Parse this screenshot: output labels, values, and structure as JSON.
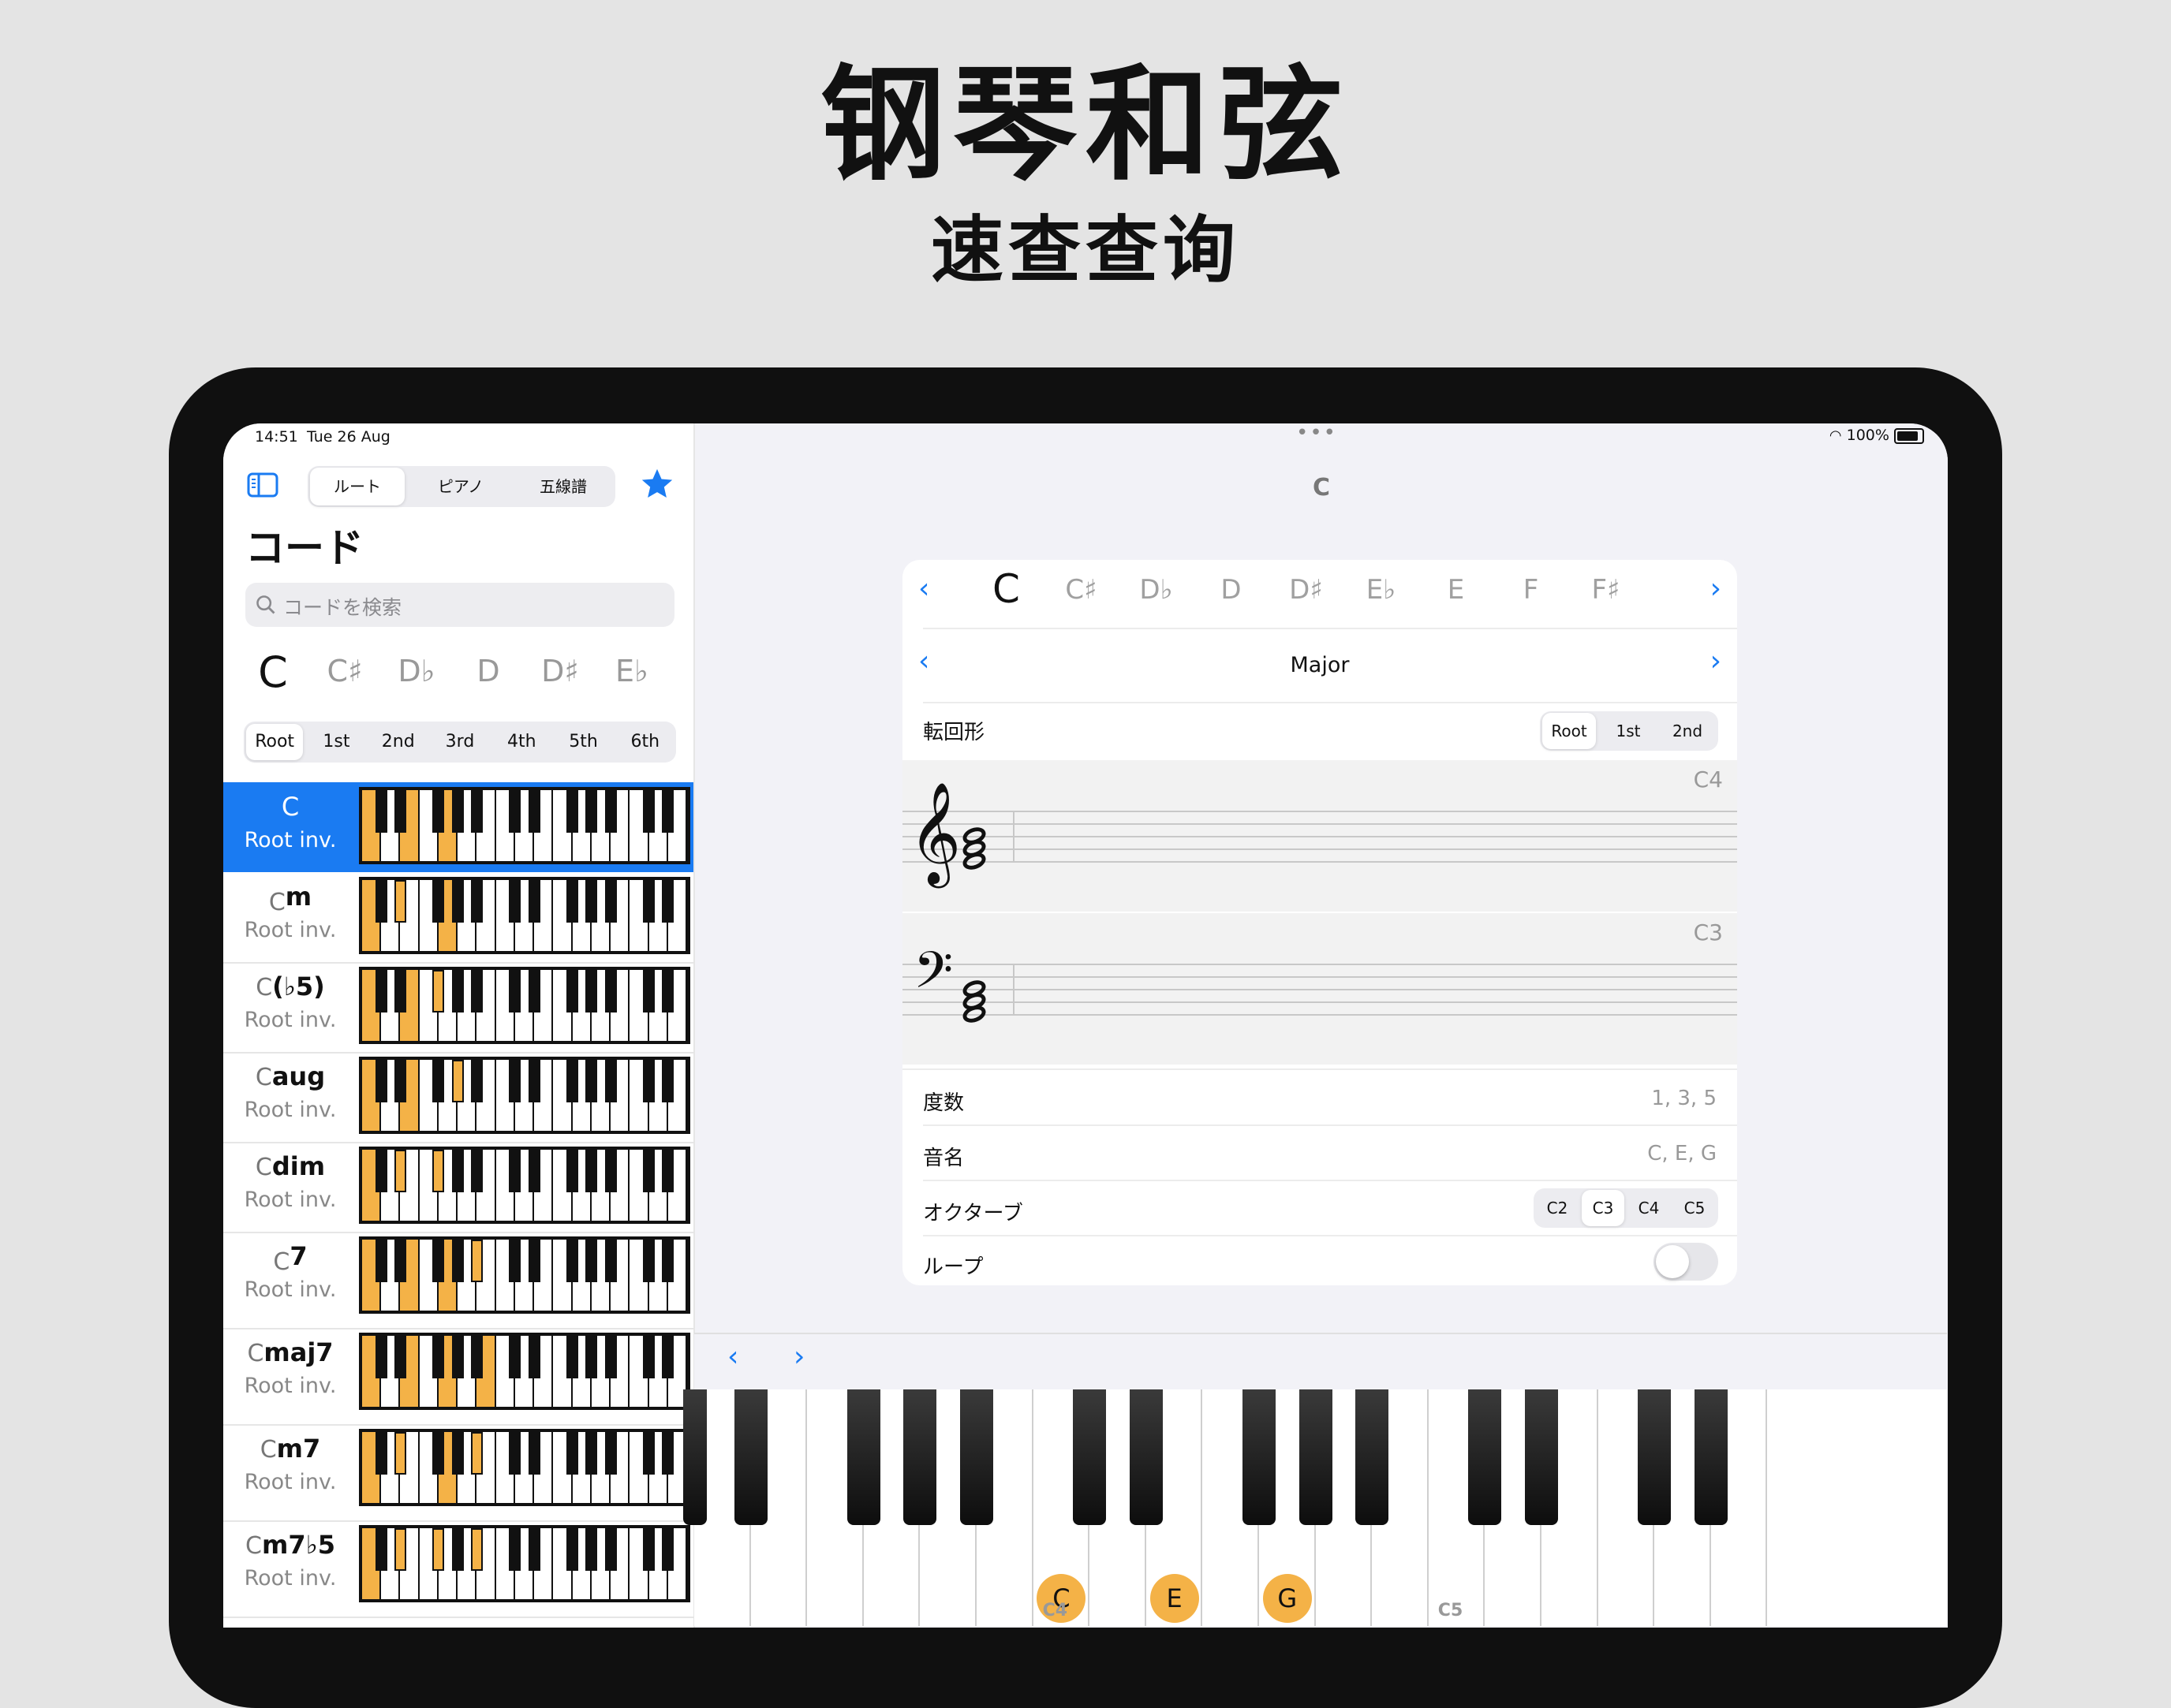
{
  "promo": {
    "title": "钢琴和弦",
    "subtitle": "速查查询"
  },
  "status": {
    "time": "14:51",
    "date": "Tue 26 Aug",
    "battery": "100%"
  },
  "sidebar": {
    "mode_tabs": [
      "ルート",
      "ピアノ",
      "五線譜"
    ],
    "mode_selected": 0,
    "heading": "コード",
    "search_placeholder": "コードを検索",
    "root_notes": [
      "C",
      "C♯",
      "D♭",
      "D",
      "D♯",
      "E♭"
    ],
    "root_selected": 0,
    "inversions": [
      "Root",
      "1st",
      "2nd",
      "3rd",
      "4th",
      "5th",
      "6th"
    ],
    "inversion_selected": 0,
    "chords": [
      {
        "root": "C",
        "quality": "",
        "inv": "Root inv.",
        "notes": [
          0,
          4,
          7
        ],
        "selected": true
      },
      {
        "root": "C",
        "quality": "m",
        "inv": "Root inv.",
        "notes": [
          0,
          3,
          7
        ],
        "selected": false
      },
      {
        "root": "C",
        "quality": "(♭5)",
        "inv": "Root inv.",
        "notes": [
          0,
          4,
          6
        ],
        "selected": false
      },
      {
        "root": "C",
        "quality": "aug",
        "inv": "Root inv.",
        "notes": [
          0,
          4,
          8
        ],
        "selected": false
      },
      {
        "root": "C",
        "quality": "dim",
        "inv": "Root inv.",
        "notes": [
          0,
          3,
          6
        ],
        "selected": false
      },
      {
        "root": "C",
        "quality": "7",
        "inv": "Root inv.",
        "notes": [
          0,
          4,
          7,
          10
        ],
        "selected": false
      },
      {
        "root": "C",
        "quality": "maj7",
        "inv": "Root inv.",
        "notes": [
          0,
          4,
          7,
          11
        ],
        "selected": false
      },
      {
        "root": "C",
        "quality": "m7",
        "inv": "Root inv.",
        "notes": [
          0,
          3,
          7,
          10
        ],
        "selected": false
      },
      {
        "root": "C",
        "quality": "m7♭5",
        "inv": "Root inv.",
        "notes": [
          0,
          3,
          6,
          10
        ],
        "selected": false
      }
    ]
  },
  "detail": {
    "title": "C",
    "note_nav": [
      "C",
      "C♯",
      "D♭",
      "D",
      "D♯",
      "E♭",
      "E",
      "F",
      "F♯"
    ],
    "note_selected": 0,
    "quality": "Major",
    "inversion_label": "転回形",
    "inversion_options": [
      "Root",
      "1st",
      "2nd"
    ],
    "inversion_selected": 0,
    "treble_octave": "C4",
    "bass_octave": "C3",
    "degree_label": "度数",
    "degree_value": "1, 3, 5",
    "notename_label": "音名",
    "notename_value": "C, E, G",
    "octave_label": "オクターブ",
    "octave_options": [
      "C2",
      "C3",
      "C4",
      "C5"
    ],
    "octave_selected": 1,
    "loop_label": "ループ",
    "loop_on": false
  },
  "piano": {
    "highlight": [
      {
        "label": "C",
        "semitone": 0
      },
      {
        "label": "E",
        "semitone": 4
      },
      {
        "label": "G",
        "semitone": 7
      }
    ],
    "octave_labels": [
      "C4",
      "C5"
    ],
    "highlight_color": "#f4b247",
    "accent_color": "#1a7bf2"
  }
}
